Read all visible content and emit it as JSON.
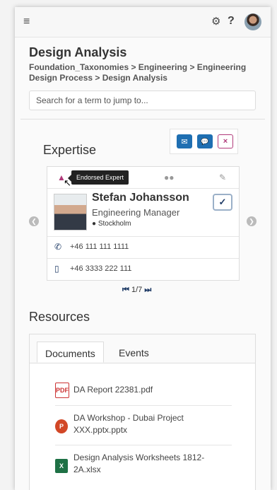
{
  "topbar": {
    "menu_icon": "≡",
    "settings_icon": "⚙",
    "help_icon": "?"
  },
  "page": {
    "title": "Design Analysis",
    "breadcrumb": "Foundation_Taxonomies > Engineering > Engineering Design Process > Design Analysis"
  },
  "search": {
    "placeholder": "Search for a term to jump to..."
  },
  "actions": {
    "email_icon": "✉",
    "chat_icon": "💬",
    "close_icon": "×"
  },
  "expertise": {
    "title": "Expertise",
    "tooltip": "Endorsed Expert",
    "person": {
      "name": "Stefan Johansson",
      "role": "Engineering Manager",
      "location": "Stockholm"
    },
    "phone": "+46 111 111 1111",
    "mobile": "+46 3333 222 111",
    "pager": {
      "first_icon": "⏮",
      "label": "1/7",
      "last_icon": "⏭"
    }
  },
  "resources": {
    "title": "Resources",
    "tabs": [
      "Documents",
      "Events"
    ],
    "files": [
      {
        "name": "DA Report 22381.pdf",
        "type": "pdf",
        "icon": "PDF"
      },
      {
        "name": "DA Workshop - Dubai Project XXX.pptx.pptx",
        "type": "pptx",
        "icon": "P"
      },
      {
        "name": "Design Analysis Worksheets 1812-2A.xlsx",
        "type": "xlsx",
        "icon": "X"
      }
    ]
  },
  "colors": {
    "accent_blue": "#1f6fb2",
    "accent_magenta": "#b03a7a",
    "navy": "#1f3b66"
  }
}
